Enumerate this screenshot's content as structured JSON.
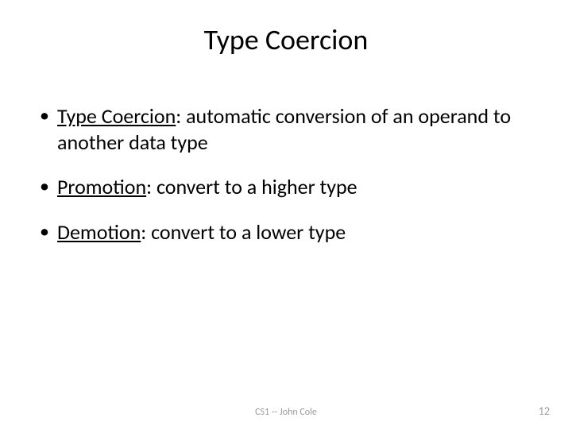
{
  "title": "Type Coercion",
  "bullets": [
    {
      "term": "Type Coercion",
      "rest": ": automatic conversion of an operand to another data type"
    },
    {
      "term": "Promotion",
      "rest": ": convert to a higher type"
    },
    {
      "term": "Demotion",
      "rest": ": convert to a lower type"
    }
  ],
  "footer": {
    "center": "CS1 -- John Cole",
    "page": "12"
  }
}
